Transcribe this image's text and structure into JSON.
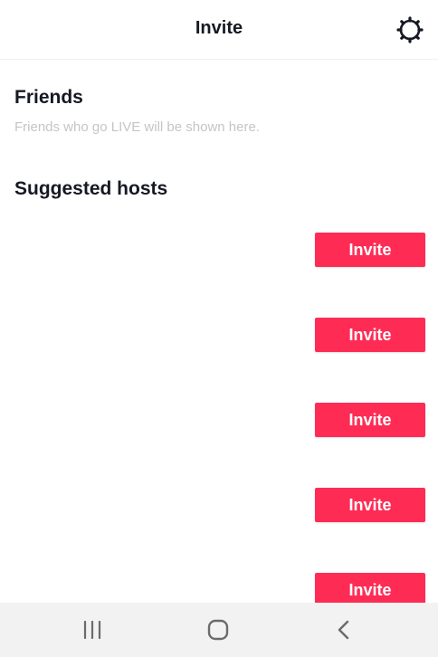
{
  "header": {
    "title": "Invite",
    "settings_icon": "gear-icon"
  },
  "friends": {
    "title": "Friends",
    "subtitle": "Friends who go LIVE will be shown here."
  },
  "suggested": {
    "title": "Suggested hosts",
    "hosts": [
      {
        "invite_label": "Invite"
      },
      {
        "invite_label": "Invite"
      },
      {
        "invite_label": "Invite"
      },
      {
        "invite_label": "Invite"
      },
      {
        "invite_label": "Invite"
      }
    ]
  },
  "navbar": {
    "recents_icon": "recent-apps-icon",
    "home_icon": "home-icon",
    "back_icon": "back-icon"
  },
  "colors": {
    "accent": "#fe2c55",
    "text": "#161823",
    "subtext": "#c4c5c9",
    "navbar": "#f2f2f2"
  }
}
